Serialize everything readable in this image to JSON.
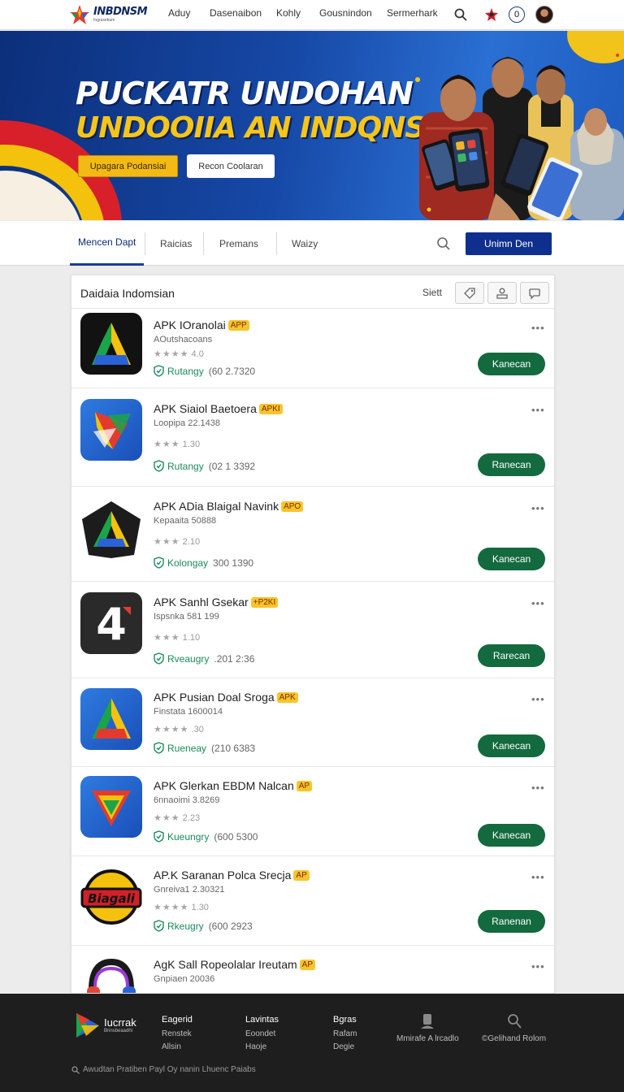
{
  "brand": {
    "name": "INBDNSM",
    "tagline": "Ingrusebum"
  },
  "topnav": {
    "links": [
      "Aduy",
      "Dasenaibon",
      "Kohly",
      "Gousnindon",
      "Sermerhark"
    ],
    "notification_count": "0"
  },
  "hero": {
    "title_line1": "PUCKATR UNDOHAN",
    "title_line2": "UNDOOIIA AN INDQNSIA",
    "primary_button": "Upagara Podansiai",
    "secondary_button": "Recon Coolaran"
  },
  "subnav": {
    "tabs": [
      "Mencen Dapt",
      "Raicias",
      "Premans",
      "Waizy"
    ],
    "active_tab": "Mencen Dapt",
    "action_button": "Unimn Den"
  },
  "list": {
    "title": "Daidaia Indomsian",
    "sort_label": "Siett",
    "items": [
      {
        "name": "APK IOranolai",
        "tag": "APP",
        "subtitle": "AOutshacoans",
        "rating": "4.0",
        "verify_label": "Rutangy",
        "meta": "(60 2.7320",
        "button": "Kanecan"
      },
      {
        "name": "APK Siaiol Baetoera",
        "tag": "APKI",
        "subtitle": "Loopipa 22.1438",
        "rating": "1.30",
        "verify_label": "Rutangy",
        "meta": "(02 1 3392",
        "button": "Ranecan"
      },
      {
        "name": "APK ADia Blaigal Navink",
        "tag": "APO",
        "subtitle": "Kepaaita 50888",
        "rating": "2.10",
        "verify_label": "Kolongay",
        "meta": "300 1390",
        "button": "Kanecan"
      },
      {
        "name": "APK Sanhl Gsekar",
        "tag": "+P2KI",
        "subtitle": "Ispsnka 581 199",
        "rating": "1.10",
        "verify_label": "Rveaugry",
        "meta": ".201 2:36",
        "button": "Rarecan"
      },
      {
        "name": "APK Pusian Doal Sroga",
        "tag": "APK",
        "subtitle": "Finstata 1600014",
        "rating": ".30",
        "verify_label": "Rueneay",
        "meta": "(210 6383",
        "button": "Kanecan"
      },
      {
        "name": "APK Glerkan EBDM Nalcan",
        "tag": "AP",
        "subtitle": "6nnaoimi 3.8269",
        "rating": "2.23",
        "verify_label": "Kueungry",
        "meta": "(600 5300",
        "button": "Kanecan"
      },
      {
        "name": "AP.K Saranan Polca Srecja",
        "tag": "AP",
        "subtitle": "Gnreiva1 2.30321",
        "rating": "1.30",
        "verify_label": "Rkeugry",
        "meta": "(600 2923",
        "button": "Ranenan"
      },
      {
        "name": "AgK Sall Ropeolalar Ireutam",
        "tag": "AP",
        "subtitle": "Gnpiaen 20036",
        "rating": "",
        "verify_label": "",
        "meta": "",
        "button": ""
      }
    ]
  },
  "footer": {
    "brand_name": "Iucrrak",
    "brand_tag": "Brinsbeaadhi",
    "col1": {
      "heading": "Eagerid",
      "links": [
        "Renstek",
        "Allsin"
      ]
    },
    "col2": {
      "heading": "Lavintas",
      "links": [
        "Eoondet",
        "Haoje"
      ]
    },
    "col3": {
      "heading": "Bgras",
      "links": [
        "Rafam",
        "Degie"
      ]
    },
    "action1": "Mmirafe A lrcadlo",
    "action2": "©Gelihand Rolom",
    "bottom_text": "Awudtan Pratiben Payl  Oy nanin Lhuenc Paiabs"
  },
  "colors": {
    "accent_blue": "#0f2f8e",
    "download_green": "#136a3e",
    "apk_badge": "#f8c42b",
    "hero_yellow": "#f6c51a"
  }
}
